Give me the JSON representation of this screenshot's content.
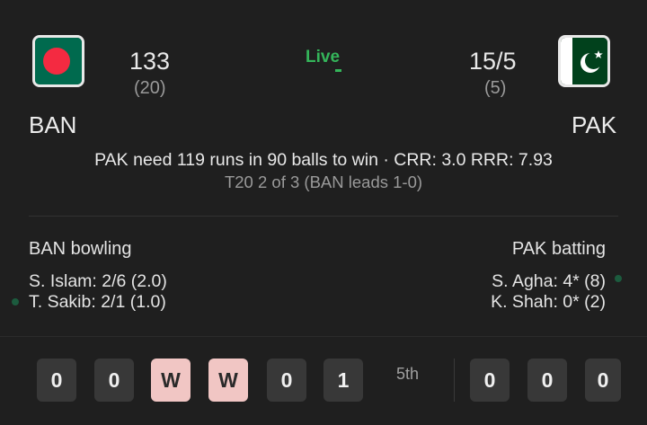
{
  "match": {
    "home": {
      "code": "BAN",
      "score": "133",
      "overs": "(20)",
      "flag_icon": "bangladesh-flag"
    },
    "away": {
      "code": "PAK",
      "score": "15/5",
      "overs": "(5)",
      "flag_icon": "pakistan-flag"
    },
    "status": "Live",
    "summary": "PAK need 119 runs in 90 balls to win · CRR: 3.0 RRR: 7.93",
    "series": "T20 2 of 3 (BAN leads 1-0)"
  },
  "bowling": {
    "title": "BAN bowling",
    "players": [
      {
        "line": "S. Islam: 2/6 (2.0)",
        "active": false
      },
      {
        "line": "T. Sakib: 2/1 (1.0)",
        "active": true
      }
    ]
  },
  "batting": {
    "title": "PAK batting",
    "players": [
      {
        "line": "S. Agha: 4* (8)",
        "active": true
      },
      {
        "line": "K. Shah: 0* (2)",
        "active": false
      }
    ]
  },
  "timeline": {
    "current_over_balls": [
      "0",
      "0",
      "W",
      "W",
      "0",
      "1"
    ],
    "over_label": "5th",
    "previous_over_balls": [
      "0",
      "0",
      "0"
    ]
  },
  "colors": {
    "background": "#1f1f1f",
    "live": "#34b55a",
    "wicket_ball": "#f1c6c4",
    "ball": "#383838",
    "bangladesh_green": "#006a4e",
    "bangladesh_red": "#f42a41",
    "pakistan_green": "#01411c",
    "active_dot": "#1c5b3e"
  }
}
